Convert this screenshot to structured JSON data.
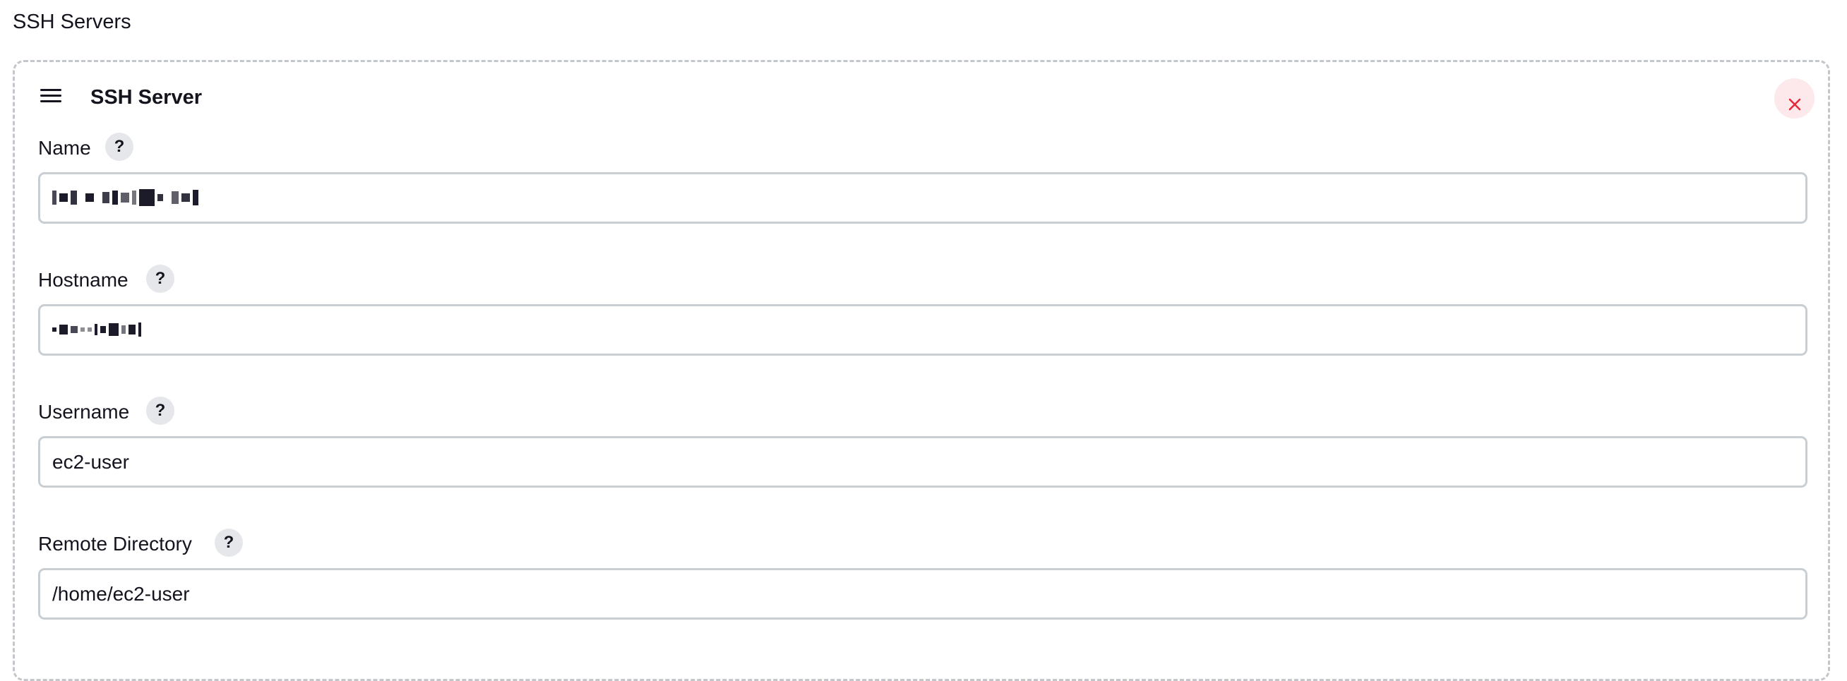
{
  "page": {
    "section_title": "SSH Servers"
  },
  "server": {
    "card_title": "SSH Server",
    "fields": {
      "name": {
        "label": "Name",
        "help": "?",
        "value": ""
      },
      "hostname": {
        "label": "Hostname",
        "help": "?",
        "value": ""
      },
      "username": {
        "label": "Username",
        "help": "?",
        "value": "ec2-user"
      },
      "remote_directory": {
        "label": "Remote Directory",
        "help": "?",
        "value": "/home/ec2-user"
      }
    }
  },
  "icons": {
    "drag_handle": "hamburger-icon",
    "delete": "close-icon",
    "help": "question-icon"
  },
  "colors": {
    "delete_bg": "#fde9eb",
    "delete_icon": "#e5283a",
    "input_border": "#c9ced3",
    "card_border": "#c3c7cc",
    "help_bg": "#e6e7ea"
  }
}
